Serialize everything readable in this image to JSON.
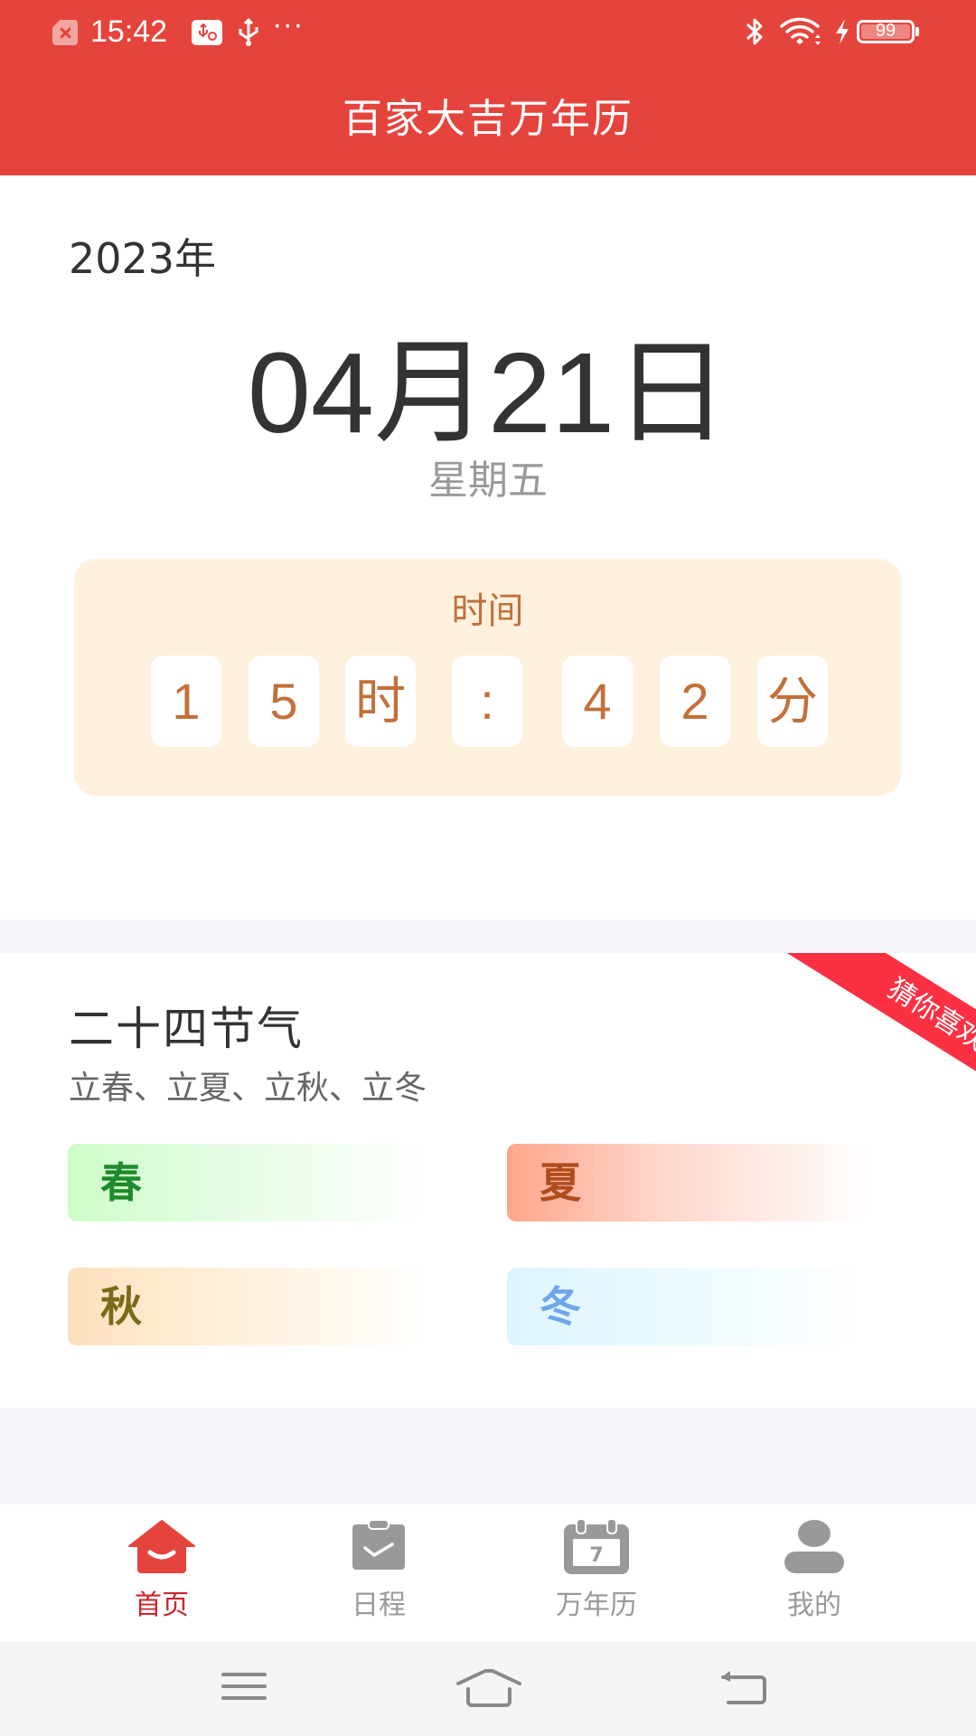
{
  "status_bar": {
    "time": "15:42",
    "battery_level": "99",
    "icons": [
      "sim-error-icon",
      "usb-settings-icon",
      "usb-icon",
      "more-icon",
      "bluetooth-icon",
      "wifi-icon",
      "charging-icon",
      "battery-icon"
    ],
    "more": "···"
  },
  "header": {
    "title": "百家大吉万年历"
  },
  "date": {
    "year": "2023年",
    "month_day": "04月21日",
    "weekday": "星期五"
  },
  "time_card": {
    "title": "时间",
    "cells": [
      "1",
      "5",
      "时",
      ":",
      "4",
      "2",
      "分"
    ]
  },
  "solar_terms": {
    "ribbon": "猜你喜欢",
    "title": "二十四节气",
    "subtitle": "立春、立夏、立秋、立冬",
    "seasons": [
      {
        "label": "春",
        "color": "#1f8a2c"
      },
      {
        "label": "夏",
        "color": "#b04d1c"
      },
      {
        "label": "秋",
        "color": "#7a6a19"
      },
      {
        "label": "冬",
        "color": "#6ea6ec"
      }
    ]
  },
  "tabbar": {
    "active_color": "#e5443d",
    "inactive_color": "#999999",
    "items": [
      {
        "label": "首页",
        "icon": "home-icon",
        "active": true
      },
      {
        "label": "日程",
        "icon": "clipboard-check-icon",
        "active": false
      },
      {
        "label": "万年历",
        "icon": "calendar-icon",
        "active": false,
        "icon_text": "7"
      },
      {
        "label": "我的",
        "icon": "user-icon",
        "active": false
      }
    ]
  },
  "colors": {
    "brand_red": "#e5443d",
    "ribbon_red": "#fb3143",
    "time_accent": "#c2703a",
    "time_card_bg": "#fff1de"
  }
}
